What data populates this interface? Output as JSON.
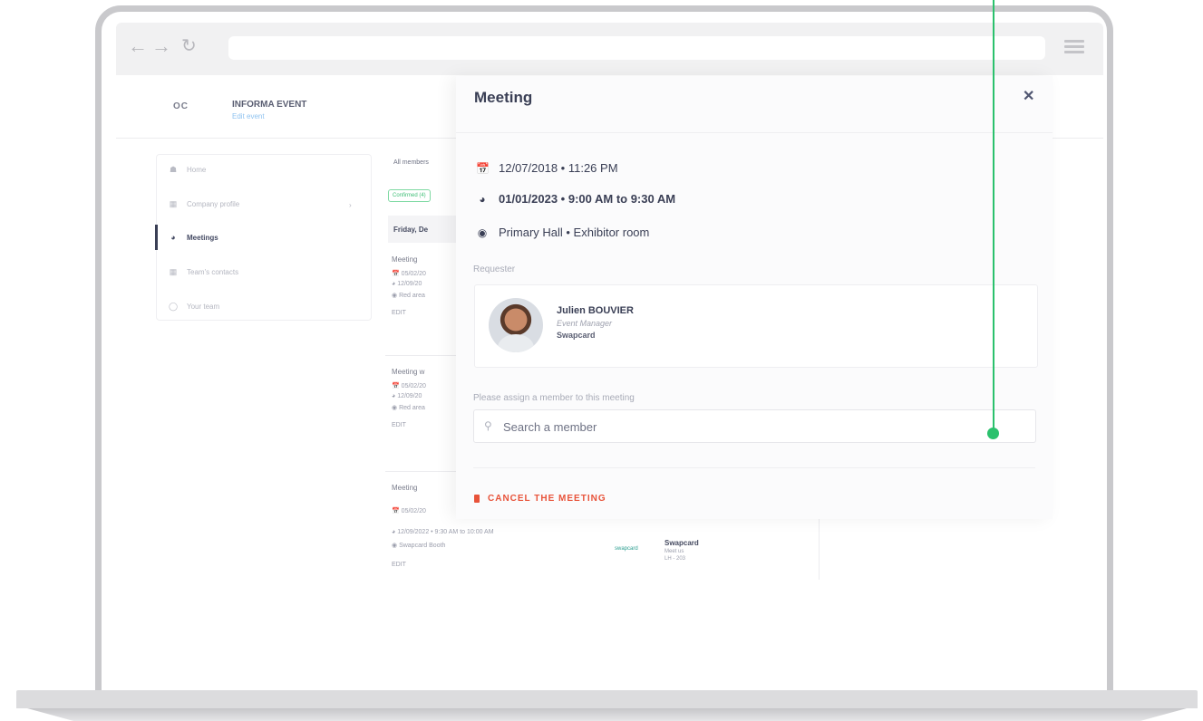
{
  "app": {
    "logo": "OC",
    "event_name": "INFORMA EVENT",
    "event_link": "Edit event"
  },
  "sidebar": {
    "items": [
      {
        "label": "Home",
        "icon": "home-icon",
        "active": false
      },
      {
        "label": "Company profile",
        "icon": "building-icon",
        "active": false
      },
      {
        "label": "Meetings",
        "icon": "chair-icon",
        "active": true
      },
      {
        "label": "Team's contacts",
        "icon": "contacts-icon",
        "active": false
      },
      {
        "label": "Your team",
        "icon": "team-icon",
        "active": false
      }
    ]
  },
  "list": {
    "filter_dropdown": "All members",
    "filter_chip": "Confirmed (4)",
    "day_header": "Friday, De",
    "cards": [
      {
        "title": "Meeting",
        "date": "05/02/20",
        "time": "12/09/20",
        "place": "Red area",
        "edit": "EDIT"
      },
      {
        "title": "Meeting w",
        "date": "05/02/20",
        "time": "12/09/20",
        "place": "Red area",
        "edit": "EDIT"
      },
      {
        "title": "Meeting",
        "date": "05/02/20",
        "time": "12/09/2022 • 9:30 AM to 10:00 AM",
        "place": "Swapcard Booth",
        "edit": "EDIT"
      }
    ],
    "brand_logo": "swapcard",
    "brand_name": "Swapcard",
    "brand_meet": "Meet us",
    "brand_booth": "LH - 203"
  },
  "modal": {
    "title": "Meeting",
    "created": "12/07/2018 • 11:26 PM",
    "slot": "01/01/2023 • 9:00 AM to 9:30 AM",
    "location": "Primary Hall • Exhibitor room",
    "requester_label": "Requester",
    "requester": {
      "name": "Julien BOUVIER",
      "role": "Event Manager",
      "company": "Swapcard"
    },
    "assign_label": "Please assign a member to this meeting",
    "search_placeholder": "Search a member",
    "cancel_label": "CANCEL THE MEETING"
  },
  "colors": {
    "accent_green": "#2bc16d",
    "danger": "#e8533a",
    "text_dark": "#3a3f55"
  }
}
